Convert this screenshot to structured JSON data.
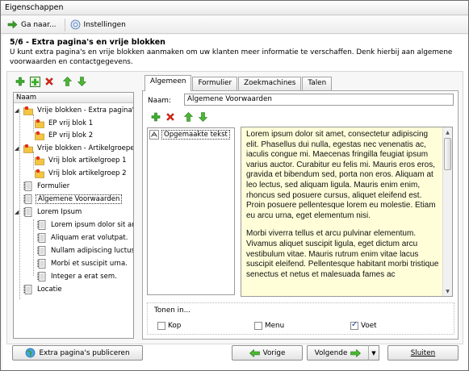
{
  "window": {
    "title": "Eigenschappen"
  },
  "toolbar": {
    "goto_label": "Ga naar...",
    "settings_label": "Instellingen"
  },
  "step": {
    "title": "5/6 - Extra pagina's en vrije blokken",
    "description": "U kunt extra pagina's en vrije blokken aanmaken om uw klanten meer informatie te verschaffen. Denk hierbij aan algemene voorwaarden en contactgegevens."
  },
  "tree": {
    "header": "Naam",
    "nodes": {
      "n1": "Vrije blokken - Extra pagina's",
      "n2": "EP vrij blok 1",
      "n3": "EP vrij blok 2",
      "n4": "Vrije blokken - Artikelgroepen",
      "n5": "Vrij blok artikelgroep 1",
      "n6": "Vrij blok artikelgroep 2",
      "n7": "Formulier",
      "n8": "Algemene Voorwaarden",
      "n9": "Lorem Ipsum",
      "n10": "Lorem ipsum dolor sit ame",
      "n11": "Aliquam erat volutpat.",
      "n12": "Nullam adipiscing luctus s",
      "n13": "Morbi et suscipit urna.",
      "n14": "Integer a erat sem.",
      "n15": "Locatie"
    }
  },
  "tabs": {
    "t1": "Algemeen",
    "t2": "Formulier",
    "t3": "Zoekmachines",
    "t4": "Talen"
  },
  "form": {
    "name_label": "Naam:",
    "name_value": "Algemene Voorwaarden"
  },
  "blocks": {
    "item1": "Opgemaakte tekst"
  },
  "preview": {
    "p1": "Lorem ipsum dolor sit amet, consectetur adipiscing elit. Phasellus dui nulla, egestas nec venenatis ac, iaculis congue mi. Maecenas fringilla feugiat ipsum varius auctor. Curabitur eu felis mi. Mauris eros eros, gravida et bibendum sed, porta non eros. Aliquam at leo lectus, sed aliquam ligula. Mauris enim enim, rhoncus sed posuere cursus, aliquet eleifend est. Proin posuere pellentesque lorem eu molestie. Etiam eu arcu urna, eget elementum nisi.",
    "p2": "Morbi viverra tellus et arcu pulvinar elementum. Vivamus aliquet suscipit ligula, eget dictum arcu vestibulum vitae. Mauris rutrum enim vitae lacus suscipit eleifend. Pellentesque habitant morbi tristique senectus et netus et malesuada fames ac"
  },
  "show_in": {
    "label": "Tonen in...",
    "kop_label": "Kop",
    "kop_checked": false,
    "menu_label": "Menu",
    "menu_checked": false,
    "voet_label": "Voet",
    "voet_checked": true
  },
  "footer": {
    "publish_label": "Extra pagina's publiceren",
    "prev_label": "Vorige",
    "next_label": "Volgende",
    "close_label": "Sluiten"
  }
}
